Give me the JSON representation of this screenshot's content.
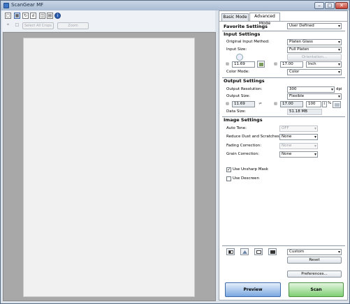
{
  "window": {
    "title": "ScanGear MF",
    "min": "–",
    "max": "□",
    "close": "✕"
  },
  "toolbar": {
    "icons": [
      "crop-icon",
      "multi-crop-icon",
      "rotate-icon",
      "zoom-icon",
      "layout-icon",
      "monitor-icon",
      "info-icon"
    ],
    "select_all_crops": "Select All Crops",
    "zoom": "Zoom"
  },
  "tabs": {
    "basic": "Basic Mode",
    "advanced": "Advanced Mode"
  },
  "favorite": {
    "label": "Favorite Settings",
    "value": "User Defined"
  },
  "input": {
    "heading": "Input Settings",
    "method_label": "Original Input Method:",
    "method_value": "Platen Glass",
    "size_label": "Input Size:",
    "size_value": "Full Platen",
    "orientation": "Orientation...",
    "width": "11.69",
    "height": "17.00",
    "unit": "Inch",
    "color_label": "Color Mode:",
    "color_value": "Color"
  },
  "output": {
    "heading": "Output Settings",
    "res_label": "Output Resolution:",
    "res_value": "300",
    "res_unit": "dpi",
    "size_label": "Output Size:",
    "size_value": "Flexible",
    "width": "11.69",
    "height": "17.00",
    "scale": "100",
    "scale_unit": "%",
    "data_size_label": "Data Size:",
    "data_size_value": "51.18 MB"
  },
  "image": {
    "heading": "Image Settings",
    "auto_tone_label": "Auto Tone:",
    "auto_tone_value": "OFF",
    "dust_label": "Reduce Dust and Scratches:",
    "dust_value": "None",
    "fading_label": "Fading Correction:",
    "fading_value": "None",
    "grain_label": "Grain Correction:",
    "grain_value": "None",
    "unsharp_label": "Use Unsharp Mask",
    "unsharp_checked": "✓",
    "descreen_label": "Use Descreen"
  },
  "adjust": {
    "preset": "Custom",
    "reset": "Reset",
    "preferences": "Preferences..."
  },
  "actions": {
    "preview": "Preview",
    "scan": "Scan"
  }
}
